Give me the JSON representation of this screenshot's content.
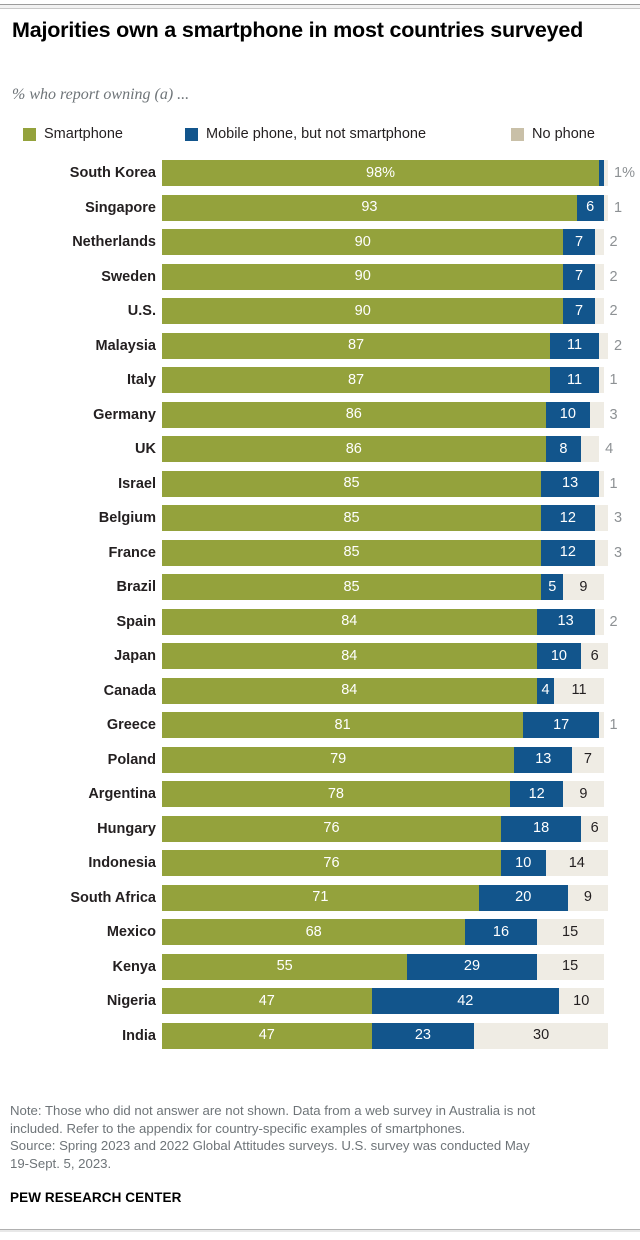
{
  "header": {
    "title": "Majorities own a smartphone in most countries surveyed",
    "subtitle": "% who report owning (a) ..."
  },
  "legend": {
    "items": [
      {
        "label": "Smartphone",
        "color": "#94a23c"
      },
      {
        "label": "Mobile phone, but not smartphone",
        "color": "#12558c"
      },
      {
        "label": "No phone",
        "color": "#c9c0a8"
      }
    ]
  },
  "footer": {
    "note_line1": "Note: Those who did not answer are not shown. Data from a web survey in Australia is not",
    "note_line2": "included. Refer to the appendix for country-specific examples of smartphones.",
    "source_line1": "Source: Spring 2023 and 2022 Global Attitudes surveys. U.S. survey was conducted May",
    "source_line2": "19-Sept. 5, 2023.",
    "brand": "PEW RESEARCH CENTER"
  },
  "chart_data": {
    "type": "bar",
    "orientation": "horizontal",
    "stacked": true,
    "title": "Majorities own a smartphone in most countries surveyed",
    "subtitle": "% who report owning (a) ...",
    "xlabel": "",
    "ylabel": "",
    "xlim": [
      0,
      100
    ],
    "grid": false,
    "legend_position": "top",
    "series": [
      {
        "name": "Smartphone",
        "color": "#94a23c"
      },
      {
        "name": "Mobile phone, but not smartphone",
        "color": "#12558c"
      },
      {
        "name": "No phone",
        "color": "#efece4"
      }
    ],
    "categories": [
      "South Korea",
      "Singapore",
      "Netherlands",
      "Sweden",
      "U.S.",
      "Malaysia",
      "Italy",
      "Germany",
      "UK",
      "Israel",
      "Belgium",
      "France",
      "Brazil",
      "Spain",
      "Japan",
      "Canada",
      "Greece",
      "Poland",
      "Argentina",
      "Hungary",
      "Indonesia",
      "South Africa",
      "Mexico",
      "Kenya",
      "Nigeria",
      "India"
    ],
    "rows": [
      {
        "country": "South Korea",
        "smartphone": 98,
        "smartphone_label": "98%",
        "mobile": 1,
        "mobile_label": "",
        "nophone": 1,
        "nophone_label": "1%"
      },
      {
        "country": "Singapore",
        "smartphone": 93,
        "smartphone_label": "93",
        "mobile": 6,
        "mobile_label": "6",
        "nophone": 1,
        "nophone_label": "1"
      },
      {
        "country": "Netherlands",
        "smartphone": 90,
        "smartphone_label": "90",
        "mobile": 7,
        "mobile_label": "7",
        "nophone": 2,
        "nophone_label": "2"
      },
      {
        "country": "Sweden",
        "smartphone": 90,
        "smartphone_label": "90",
        "mobile": 7,
        "mobile_label": "7",
        "nophone": 2,
        "nophone_label": "2"
      },
      {
        "country": "U.S.",
        "smartphone": 90,
        "smartphone_label": "90",
        "mobile": 7,
        "mobile_label": "7",
        "nophone": 2,
        "nophone_label": "2"
      },
      {
        "country": "Malaysia",
        "smartphone": 87,
        "smartphone_label": "87",
        "mobile": 11,
        "mobile_label": "11",
        "nophone": 2,
        "nophone_label": "2"
      },
      {
        "country": "Italy",
        "smartphone": 87,
        "smartphone_label": "87",
        "mobile": 11,
        "mobile_label": "11",
        "nophone": 1,
        "nophone_label": "1"
      },
      {
        "country": "Germany",
        "smartphone": 86,
        "smartphone_label": "86",
        "mobile": 10,
        "mobile_label": "10",
        "nophone": 3,
        "nophone_label": "3"
      },
      {
        "country": "UK",
        "smartphone": 86,
        "smartphone_label": "86",
        "mobile": 8,
        "mobile_label": "8",
        "nophone": 4,
        "nophone_label": "4"
      },
      {
        "country": "Israel",
        "smartphone": 85,
        "smartphone_label": "85",
        "mobile": 13,
        "mobile_label": "13",
        "nophone": 1,
        "nophone_label": "1"
      },
      {
        "country": "Belgium",
        "smartphone": 85,
        "smartphone_label": "85",
        "mobile": 12,
        "mobile_label": "12",
        "nophone": 3,
        "nophone_label": "3"
      },
      {
        "country": "France",
        "smartphone": 85,
        "smartphone_label": "85",
        "mobile": 12,
        "mobile_label": "12",
        "nophone": 3,
        "nophone_label": "3"
      },
      {
        "country": "Brazil",
        "smartphone": 85,
        "smartphone_label": "85",
        "mobile": 5,
        "mobile_label": "5",
        "nophone": 9,
        "nophone_label": "9"
      },
      {
        "country": "Spain",
        "smartphone": 84,
        "smartphone_label": "84",
        "mobile": 13,
        "mobile_label": "13",
        "nophone": 2,
        "nophone_label": "2"
      },
      {
        "country": "Japan",
        "smartphone": 84,
        "smartphone_label": "84",
        "mobile": 10,
        "mobile_label": "10",
        "nophone": 6,
        "nophone_label": "6"
      },
      {
        "country": "Canada",
        "smartphone": 84,
        "smartphone_label": "84",
        "mobile": 4,
        "mobile_label": "4",
        "nophone": 11,
        "nophone_label": "11"
      },
      {
        "country": "Greece",
        "smartphone": 81,
        "smartphone_label": "81",
        "mobile": 17,
        "mobile_label": "17",
        "nophone": 1,
        "nophone_label": "1"
      },
      {
        "country": "Poland",
        "smartphone": 79,
        "smartphone_label": "79",
        "mobile": 13,
        "mobile_label": "13",
        "nophone": 7,
        "nophone_label": "7"
      },
      {
        "country": "Argentina",
        "smartphone": 78,
        "smartphone_label": "78",
        "mobile": 12,
        "mobile_label": "12",
        "nophone": 9,
        "nophone_label": "9"
      },
      {
        "country": "Hungary",
        "smartphone": 76,
        "smartphone_label": "76",
        "mobile": 18,
        "mobile_label": "18",
        "nophone": 6,
        "nophone_label": "6"
      },
      {
        "country": "Indonesia",
        "smartphone": 76,
        "smartphone_label": "76",
        "mobile": 10,
        "mobile_label": "10",
        "nophone": 14,
        "nophone_label": "14"
      },
      {
        "country": "South Africa",
        "smartphone": 71,
        "smartphone_label": "71",
        "mobile": 20,
        "mobile_label": "20",
        "nophone": 9,
        "nophone_label": "9"
      },
      {
        "country": "Mexico",
        "smartphone": 68,
        "smartphone_label": "68",
        "mobile": 16,
        "mobile_label": "16",
        "nophone": 15,
        "nophone_label": "15"
      },
      {
        "country": "Kenya",
        "smartphone": 55,
        "smartphone_label": "55",
        "mobile": 29,
        "mobile_label": "29",
        "nophone": 15,
        "nophone_label": "15"
      },
      {
        "country": "Nigeria",
        "smartphone": 47,
        "smartphone_label": "47",
        "mobile": 42,
        "mobile_label": "42",
        "nophone": 10,
        "nophone_label": "10"
      },
      {
        "country": "India",
        "smartphone": 47,
        "smartphone_label": "47",
        "mobile": 23,
        "mobile_label": "23",
        "nophone": 30,
        "nophone_label": "30"
      }
    ]
  }
}
